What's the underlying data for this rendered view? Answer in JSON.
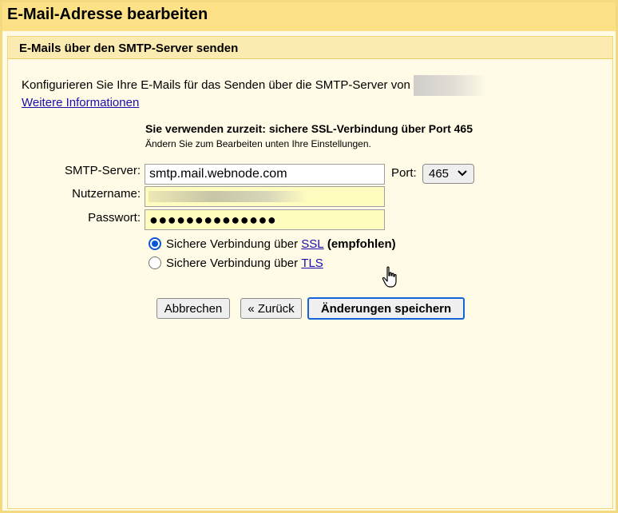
{
  "dialog": {
    "title": "E-Mail-Adresse bearbeiten",
    "section_title": "E-Mails über den SMTP-Server senden"
  },
  "intro": {
    "text": "Konfigurieren Sie Ihre E-Mails für das Senden über die SMTP-Server von",
    "more_info_link": "Weitere Informationen"
  },
  "status": {
    "main": "Sie verwenden zurzeit: sichere SSL-Verbindung über Port 465",
    "sub": "Ändern Sie zum Bearbeiten unten Ihre Einstellungen."
  },
  "form": {
    "smtp_label": "SMTP-Server:",
    "smtp_value": "smtp.mail.webnode.com",
    "port_label": "Port:",
    "port_value": "465",
    "username_label": "Nutzername:",
    "password_label": "Passwort:",
    "password_mask": "●●●●●●●●●●●●●●"
  },
  "security": {
    "ssl_prefix": "Sichere Verbindung über",
    "ssl_link": "SSL",
    "ssl_suffix": "(empfohlen)",
    "ssl_selected": true,
    "tls_prefix": "Sichere Verbindung über",
    "tls_link": "TLS",
    "tls_selected": false
  },
  "buttons": {
    "cancel": "Abbrechen",
    "back": "« Zurück",
    "save": "Änderungen speichern"
  },
  "colors": {
    "title_bar": "#fce186",
    "background": "#fffbe6",
    "link": "#1a0dab",
    "accent": "#0b57d0"
  }
}
